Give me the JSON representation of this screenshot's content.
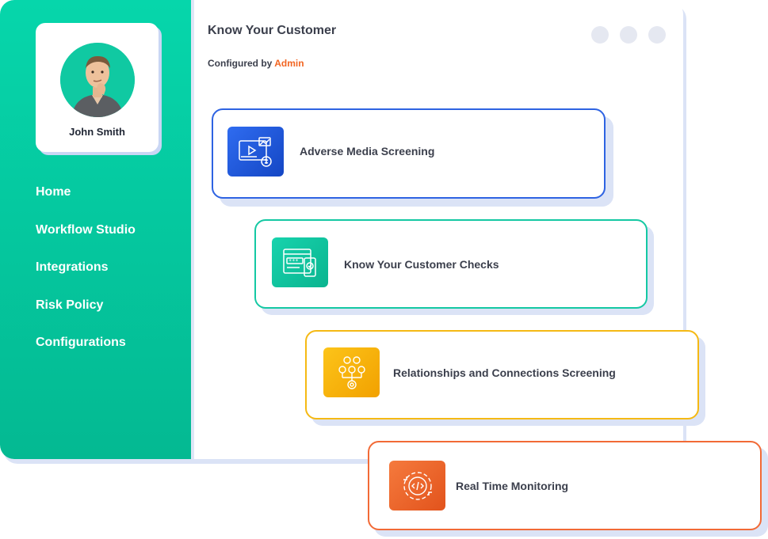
{
  "user": {
    "name": "John Smith"
  },
  "nav": {
    "items": [
      {
        "label": "Home"
      },
      {
        "label": "Workflow Studio"
      },
      {
        "label": "Integrations"
      },
      {
        "label": "Risk Policy"
      },
      {
        "label": "Configurations"
      }
    ]
  },
  "header": {
    "title": "Know Your Customer",
    "configured_prefix": "Configured by",
    "configured_by": "Admin"
  },
  "cards": [
    {
      "label": "Adverse Media Screening",
      "icon": "media-screening-icon",
      "color": "#2e63e2"
    },
    {
      "label": "Know Your Customer Checks",
      "icon": "kyc-checks-icon",
      "color": "#14c8a3"
    },
    {
      "label": "Relationships and Connections Screening",
      "icon": "relationships-icon",
      "color": "#f5b914"
    },
    {
      "label": "Real Time Monitoring",
      "icon": "monitoring-icon",
      "color": "#f26a36"
    }
  ],
  "colors": {
    "sidebar": "#06d6ab",
    "accent_admin": "#f26522"
  }
}
